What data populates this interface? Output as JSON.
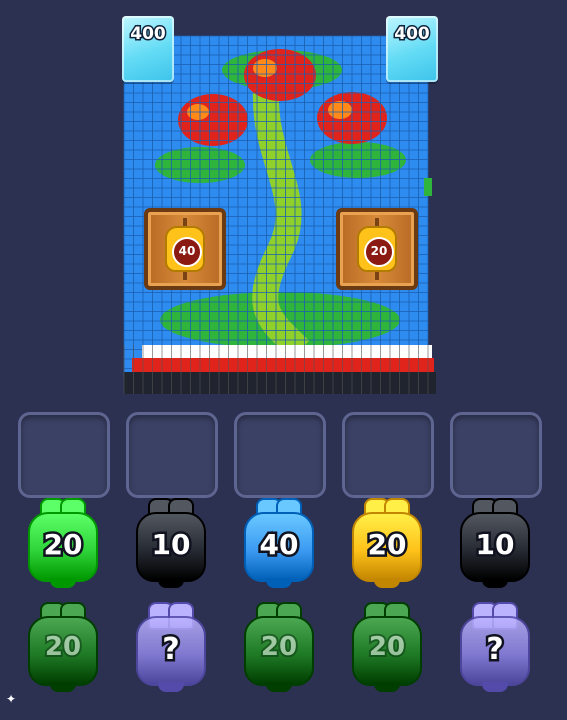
{
  "ice_blocks": [
    {
      "label": "400"
    },
    {
      "label": "400"
    }
  ],
  "crates": [
    {
      "count": "40"
    },
    {
      "count": "20"
    }
  ],
  "jars_top": [
    {
      "count": "20",
      "color": "green",
      "hex": "#2fd43a"
    },
    {
      "count": "10",
      "color": "black",
      "hex": "#262a33"
    },
    {
      "count": "40",
      "color": "blue",
      "hex": "#3c9bf2"
    },
    {
      "count": "20",
      "color": "yellow",
      "hex": "#ffc21a"
    },
    {
      "count": "10",
      "color": "black",
      "hex": "#262a33"
    }
  ],
  "jars_bottom": [
    {
      "count": "20",
      "color": "dark-green",
      "hex": "#1f7a26"
    },
    {
      "count": "?",
      "color": "mystery",
      "hex": "#8f86e6"
    },
    {
      "count": "20",
      "color": "dark-green",
      "hex": "#1f7a26"
    },
    {
      "count": "20",
      "color": "dark-green",
      "hex": "#1f7a26"
    },
    {
      "count": "?",
      "color": "mystery",
      "hex": "#8f86e6"
    }
  ],
  "palette": {
    "background": "#2c3152",
    "sky": "#2e8bf0",
    "leaf": "#2fb53c",
    "red": "#e0241c"
  }
}
